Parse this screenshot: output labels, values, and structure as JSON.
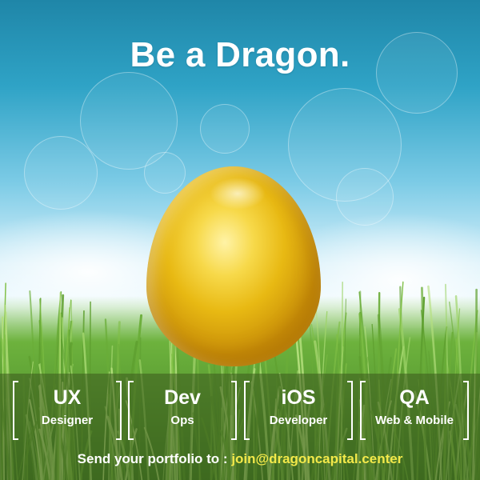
{
  "headline": "Be a Dragon.",
  "roles": [
    {
      "title": "UX",
      "subtitle": "Designer"
    },
    {
      "title": "Dev",
      "subtitle": "Ops"
    },
    {
      "title": "iOS",
      "subtitle": "Developer"
    },
    {
      "title": "QA",
      "subtitle": "Web & Mobile"
    }
  ],
  "footer": {
    "prefix": "Send your portfolio to : ",
    "email": "join@dragoncapital.center"
  },
  "colors": {
    "headline": "#ffffff",
    "email_accent": "#f3e94a",
    "egg_gold": "#e8b913"
  },
  "graphics": {
    "background": "sky-and-grass-scene",
    "centerpiece": "golden-egg"
  }
}
